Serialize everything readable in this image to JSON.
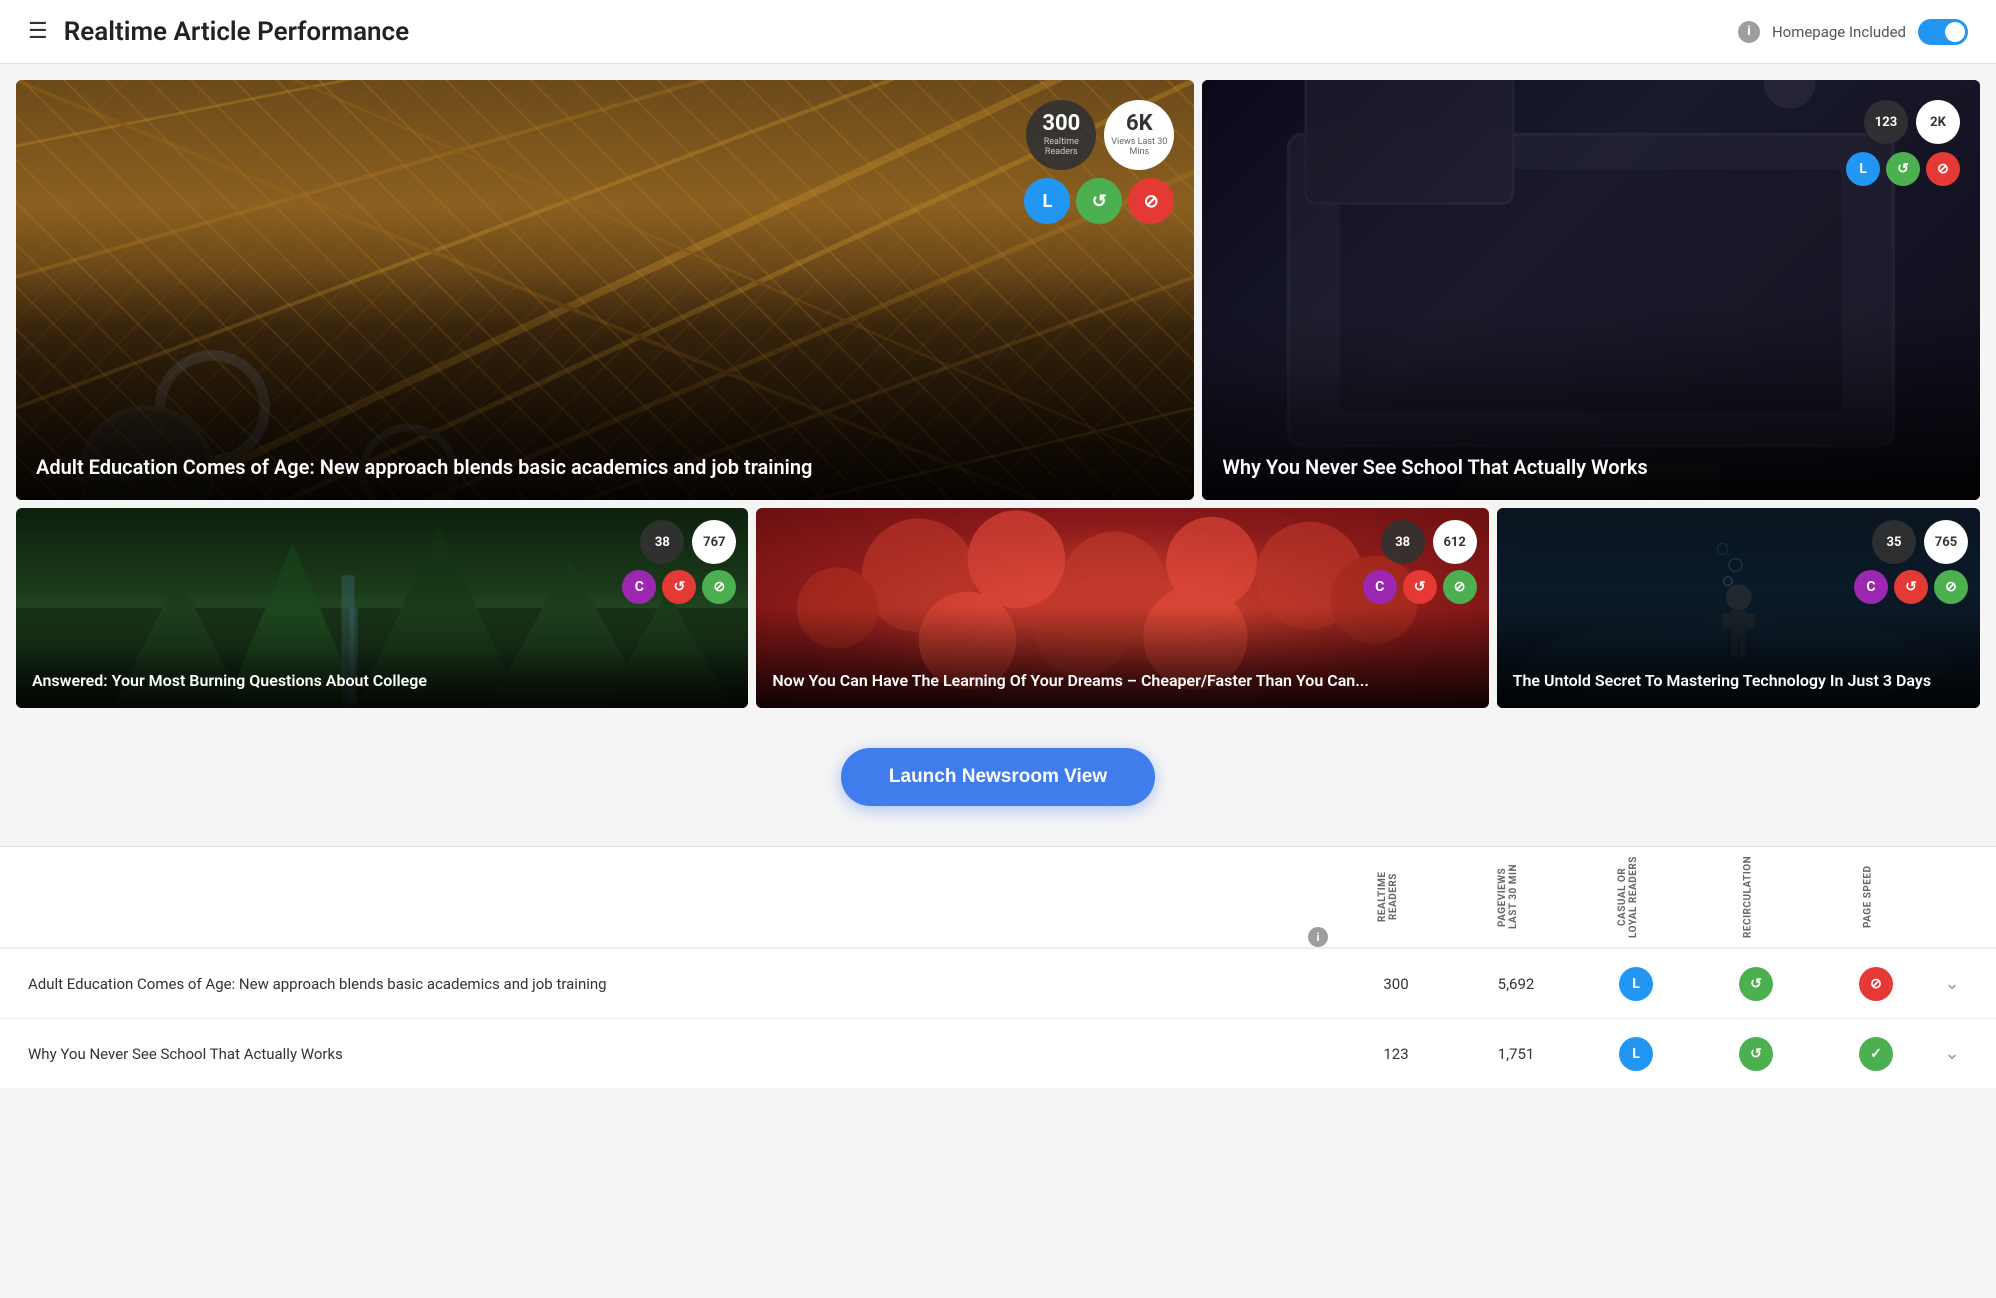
{
  "header": {
    "menu_label": "☰",
    "title": "Realtime Article Performance",
    "homepage_label": "Homepage Included",
    "info_icon": "i"
  },
  "cards": {
    "featured": {
      "title": "Adult Education Comes of Age: New approach blends basic academics and job training",
      "readers_num": "300",
      "readers_label": "Realtime Readers",
      "views_num": "6K",
      "views_label": "Views Last 30 Mins",
      "icon1": "L",
      "icon1_color": "blue",
      "icon2": "↺",
      "icon2_color": "green",
      "icon3": "⊘",
      "icon3_color": "red"
    },
    "secondary": {
      "title": "Why You Never See School That Actually Works",
      "readers_num": "123",
      "views_num": "2K",
      "icon1": "L",
      "icon1_color": "blue",
      "icon2": "↺",
      "icon2_color": "green",
      "icon3": "⊘",
      "icon3_color": "red"
    },
    "small1": {
      "title": "Answered: Your Most Burning Questions About College",
      "readers_num": "38",
      "views_num": "767",
      "icon1_color": "purple",
      "icon2_color": "red",
      "icon3_color": "green"
    },
    "small2": {
      "title": "Now You Can Have The Learning Of Your Dreams – Cheaper/Faster Than You Can...",
      "readers_num": "38",
      "views_num": "612",
      "icon1_color": "purple",
      "icon2_color": "red",
      "icon3_color": "green"
    },
    "small3": {
      "title": "The Untold Secret To Mastering Technology In Just 3 Days",
      "readers_num": "35",
      "views_num": "765",
      "icon1_color": "purple",
      "icon2_color": "red",
      "icon3_color": "green"
    }
  },
  "launch_button": "Launch Newsroom View",
  "table": {
    "columns": [
      "REALTIME READERS",
      "PAGEVIEWS LAST 30 MIN",
      "CASUAL OR LOYAL READERS",
      "RECIRCULATION",
      "PAGE SPEED"
    ],
    "rows": [
      {
        "title": "Adult Education Comes of Age: New approach blends basic academics and job training",
        "realtime": "300",
        "pageviews": "5,692",
        "loyal_color": "blue",
        "loyal_icon": "L",
        "recirc_color": "green",
        "speed_color": "red"
      },
      {
        "title": "Why You Never See School That Actually Works",
        "realtime": "123",
        "pageviews": "1,751",
        "loyal_color": "blue",
        "loyal_icon": "L",
        "recirc_color": "green",
        "speed_color": "green"
      }
    ]
  }
}
